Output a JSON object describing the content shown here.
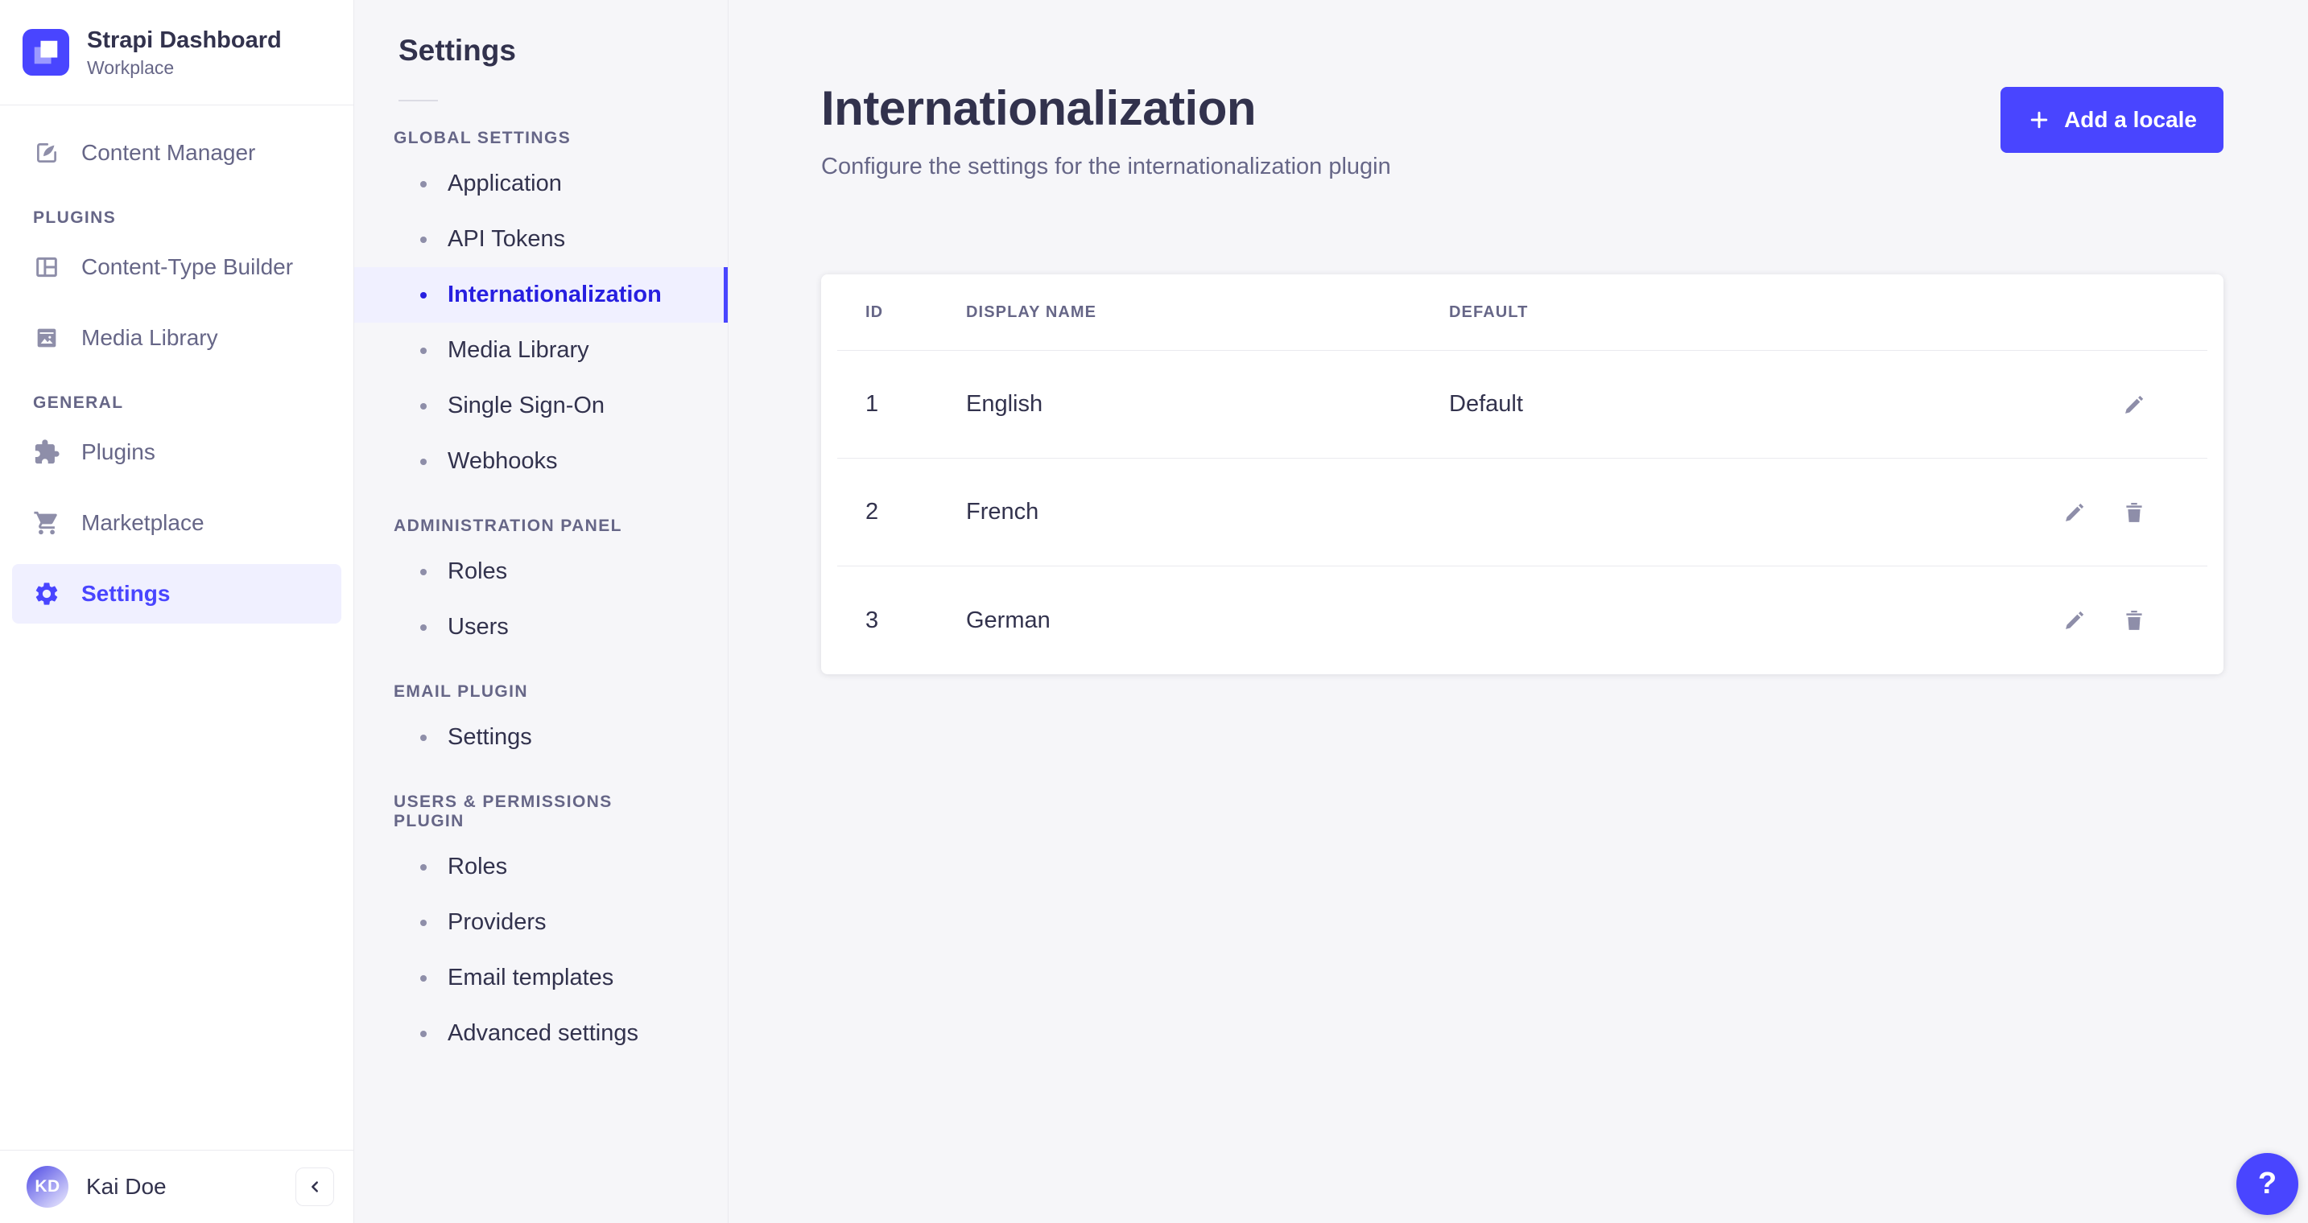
{
  "brand": {
    "title": "Strapi Dashboard",
    "subtitle": "Workplace",
    "logo_icon": "strapi-logo"
  },
  "sidebar": {
    "sections": [
      {
        "label": "",
        "items": [
          {
            "label": "Content Manager",
            "icon": "content-manager",
            "active": false
          }
        ]
      },
      {
        "label": "PLUGINS",
        "items": [
          {
            "label": "Content-Type Builder",
            "icon": "content-type-builder",
            "active": false
          },
          {
            "label": "Media Library",
            "icon": "media-library",
            "active": false
          }
        ]
      },
      {
        "label": "GENERAL",
        "items": [
          {
            "label": "Plugins",
            "icon": "plugins",
            "active": false
          },
          {
            "label": "Marketplace",
            "icon": "marketplace",
            "active": false
          },
          {
            "label": "Settings",
            "icon": "settings",
            "active": true
          }
        ]
      }
    ],
    "footer": {
      "initials": "KD",
      "name": "Kai Doe",
      "collapse_icon": "chevron-left"
    }
  },
  "subnav": {
    "title": "Settings",
    "sections": [
      {
        "label": "GLOBAL SETTINGS",
        "items": [
          {
            "label": "Application",
            "active": false
          },
          {
            "label": "API Tokens",
            "active": false
          },
          {
            "label": "Internationalization",
            "active": true
          },
          {
            "label": "Media Library",
            "active": false
          },
          {
            "label": "Single Sign-On",
            "active": false
          },
          {
            "label": "Webhooks",
            "active": false
          }
        ]
      },
      {
        "label": "ADMINISTRATION PANEL",
        "items": [
          {
            "label": "Roles",
            "active": false
          },
          {
            "label": "Users",
            "active": false
          }
        ]
      },
      {
        "label": "EMAIL PLUGIN",
        "items": [
          {
            "label": "Settings",
            "active": false
          }
        ]
      },
      {
        "label": "USERS & PERMISSIONS PLUGIN",
        "items": [
          {
            "label": "Roles",
            "active": false
          },
          {
            "label": "Providers",
            "active": false
          },
          {
            "label": "Email templates",
            "active": false
          },
          {
            "label": "Advanced settings",
            "active": false
          }
        ]
      }
    ]
  },
  "main": {
    "title": "Internationalization",
    "subtitle": "Configure the settings for the internationalization plugin",
    "add_button_label": "Add a locale",
    "table": {
      "headers": [
        "ID",
        "DISPLAY NAME",
        "DEFAULT",
        ""
      ],
      "rows": [
        {
          "id": "1",
          "name": "English",
          "default": "Default",
          "actions": [
            "edit"
          ]
        },
        {
          "id": "2",
          "name": "French",
          "default": "",
          "actions": [
            "edit",
            "delete"
          ]
        },
        {
          "id": "3",
          "name": "German",
          "default": "",
          "actions": [
            "edit",
            "delete"
          ]
        }
      ]
    }
  },
  "help": {
    "label": "?"
  },
  "colors": {
    "accent": "#4945ff",
    "accent_active_text": "#271fe0",
    "accent_bg": "#f0f0ff",
    "text_dark": "#32324d",
    "text_muted": "#666687",
    "icon_muted": "#8e8ea9",
    "border": "#eaeaef",
    "background": "#f6f6f9",
    "card": "#ffffff"
  }
}
